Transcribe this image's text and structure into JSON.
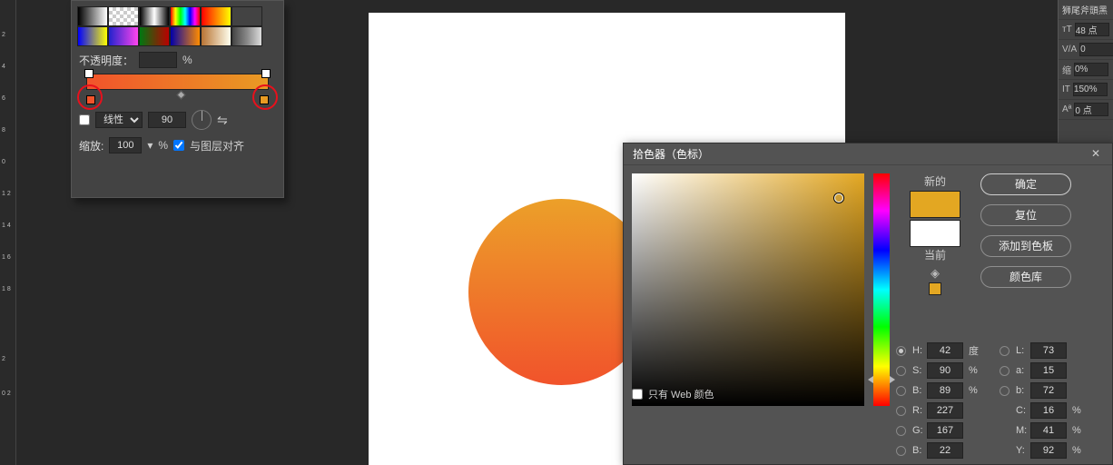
{
  "ruler": {
    "ticks": [
      "",
      "2",
      "4",
      "6",
      "8",
      "0",
      "1 2",
      "1 4",
      "1 6",
      "1 8",
      "",
      "2",
      "0 2"
    ]
  },
  "gradient_panel": {
    "presets": [
      [
        "linear-gradient(90deg,#000,#fff)",
        "repeating-conic-gradient(#ccc 0 25%,#fff 0 50%) 0/8px 8px",
        "linear-gradient(90deg,#000,#fff,#000)",
        "linear-gradient(90deg,#ff0,#f00,#00f)",
        "linear-gradient(90deg,#f00,#ff0)",
        "#434343"
      ],
      [
        "linear-gradient(90deg,#00f,#ff0)",
        "linear-gradient(90deg,#22c,#f4e)",
        "linear-gradient(90deg,#071,#b00)",
        "linear-gradient(90deg,#00a,#ff8c00)",
        "linear-gradient(90deg,#b87333,#ffe)",
        "linear-gradient(90deg,#444,#888,#ddd)"
      ]
    ],
    "opacity_label": "不透明度：",
    "opacity_unit": "%",
    "type_label": "线性",
    "angle_value": "90",
    "scale_label": "缩放:",
    "scale_value": "100",
    "scale_unit": "%",
    "align_label": "与图层对齐"
  },
  "right_panel": {
    "font_preview": "狮尾斧頭黑",
    "size": "48 点",
    "va": "0",
    "tracking": "0%",
    "vscale": "150%",
    "baseline": "0 点"
  },
  "picker": {
    "title": "拾色器（色标）",
    "new_label": "新的",
    "current_label": "当前",
    "btn_ok": "确定",
    "btn_reset": "复位",
    "btn_add": "添加到色板",
    "btn_lib": "颜色库",
    "H": "42",
    "H_unit": "度",
    "S": "90",
    "S_unit": "%",
    "Bv": "89",
    "Bv_unit": "%",
    "R": "227",
    "G": "167",
    "Bb": "22",
    "L": "73",
    "a": "15",
    "b": "72",
    "C": "16",
    "C_unit": "%",
    "M": "41",
    "M_unit": "%",
    "Y": "92",
    "Y_unit": "%",
    "web_only_label": "只有 Web 颜色",
    "labels": {
      "H": "H:",
      "S": "S:",
      "B": "B:",
      "R": "R:",
      "G": "G:",
      "Bb": "B:",
      "L": "L:",
      "a": "a:",
      "b": "b:",
      "C": "C:",
      "M": "M:",
      "Y": "Y:"
    }
  },
  "chart_data": null
}
